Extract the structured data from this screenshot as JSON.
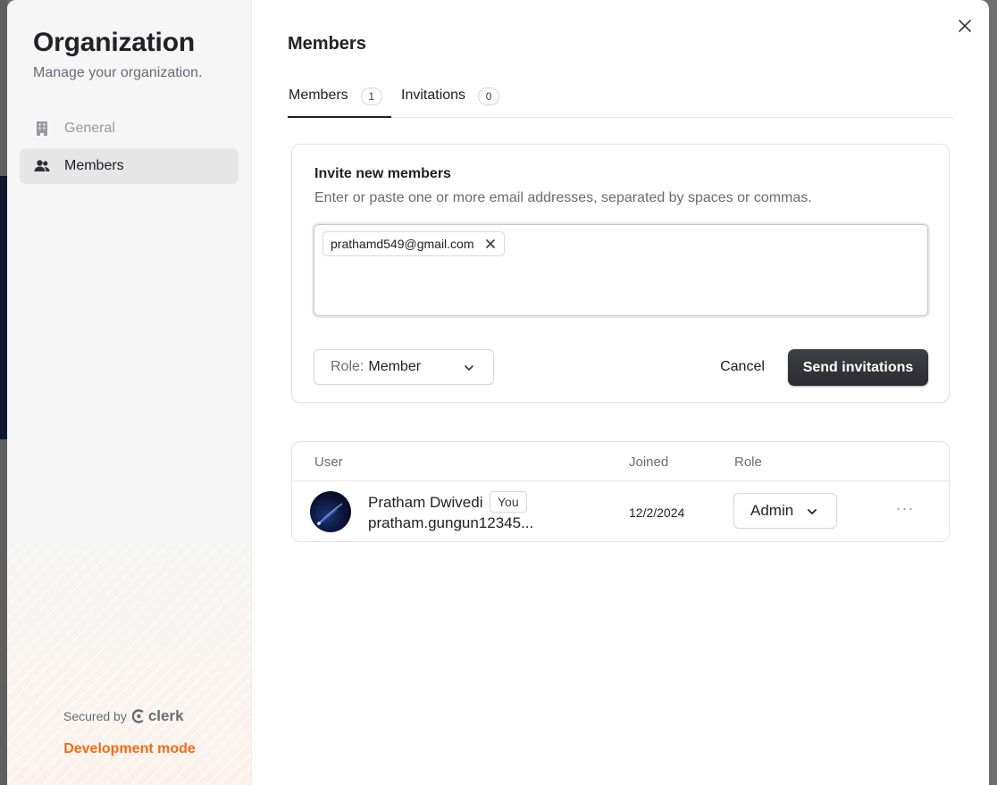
{
  "sidebar": {
    "title": "Organization",
    "subtitle": "Manage your organization.",
    "items": [
      {
        "label": "General",
        "icon": "building-icon",
        "active": false
      },
      {
        "label": "Members",
        "icon": "users-icon",
        "active": true
      }
    ],
    "secured_by": "Secured by",
    "brand": "clerk",
    "dev_mode": "Development mode"
  },
  "main": {
    "title": "Members",
    "tabs": [
      {
        "label": "Members",
        "count": "1",
        "active": true
      },
      {
        "label": "Invitations",
        "count": "0",
        "active": false
      }
    ],
    "invite": {
      "title": "Invite new members",
      "description": "Enter or paste one or more email addresses, separated by spaces or commas.",
      "emails": [
        "prathamd549@gmail.com"
      ],
      "role_prefix": "Role:",
      "role_value": "Member",
      "cancel_label": "Cancel",
      "send_label": "Send invitations"
    },
    "table": {
      "headers": {
        "user": "User",
        "joined": "Joined",
        "role": "Role"
      },
      "rows": [
        {
          "name": "Pratham Dwivedi",
          "badge": "You",
          "email": "pratham.gungun12345...",
          "joined": "12/2/2024",
          "role": "Admin",
          "more": "···"
        }
      ]
    }
  },
  "colors": {
    "accent_dark": "#2f2f35",
    "dev_mode": "#f36b16",
    "muted_text": "#6b6b74"
  }
}
